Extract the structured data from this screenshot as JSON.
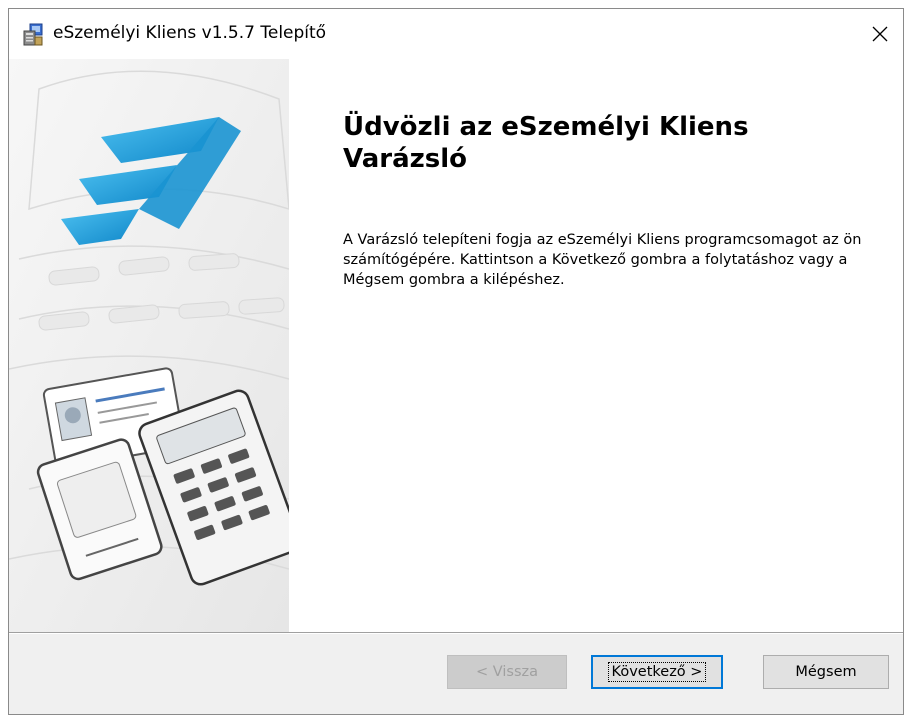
{
  "window": {
    "title": "eSzemélyi Kliens v1.5.7 Telepítő",
    "close_glyph": "✕",
    "icon": "installer-icon"
  },
  "main": {
    "heading": "Üdvözli az eSzemélyi Kliens Varázsló",
    "description": "A Varázsló telepíteni fogja az eSzemélyi Kliens programcsomagot az ön számítógépére.  Kattintson a Következő gombra a folytatáshoz vagy a Mégsem gombra a kilépéshez."
  },
  "side_panel": {
    "logo_color": "#1fa0dc"
  },
  "buttons": {
    "back_label": "< Vissza",
    "next_label": "Következő >",
    "cancel_label": "Mégsem"
  },
  "colors": {
    "accent": "#0078d7",
    "logo": "#1fa0dc"
  }
}
